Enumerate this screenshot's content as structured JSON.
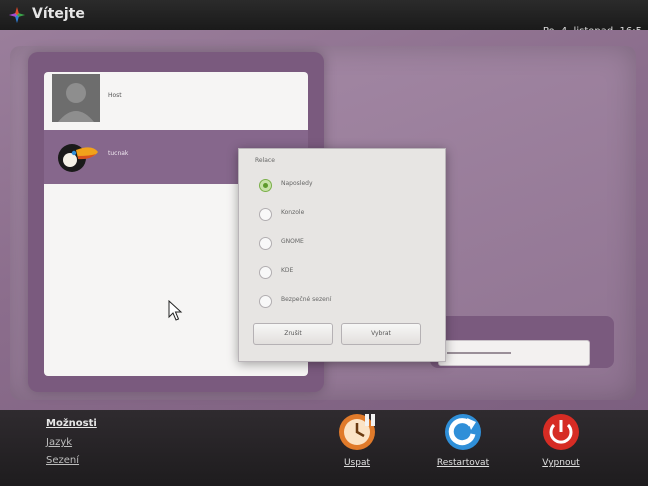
{
  "header": {
    "title": "Vítejte",
    "clock": "Po. 4. listopad, 16:5"
  },
  "users": [
    {
      "name": "Host",
      "avatar": "silhouette-avatar-icon",
      "selected": false
    },
    {
      "name": "tucnak",
      "avatar": "toucan-avatar-icon",
      "selected": true
    }
  ],
  "dialog": {
    "title": "Relace",
    "options": [
      {
        "label": "Naposledy",
        "checked": true
      },
      {
        "label": "Konzole",
        "checked": false
      },
      {
        "label": "GNOME",
        "checked": false
      },
      {
        "label": "KDE",
        "checked": false
      },
      {
        "label": "Bezpečné sezení",
        "checked": false
      }
    ],
    "buttons": {
      "cancel": "Zrušit",
      "ok": "Vybrat"
    }
  },
  "bottom": {
    "options_title": "Možnosti",
    "language": "Jazyk",
    "session": "Sezení",
    "actions": [
      {
        "label": "Uspat",
        "icon": "suspend-clock-icon"
      },
      {
        "label": "Restartovat",
        "icon": "restart-arrow-icon"
      },
      {
        "label": "Vypnout",
        "icon": "power-icon"
      }
    ]
  },
  "colors": {
    "accent": "#86678c",
    "suspend": "#e07a2a",
    "restart": "#2f8fd8",
    "shutdown": "#d62c24"
  }
}
